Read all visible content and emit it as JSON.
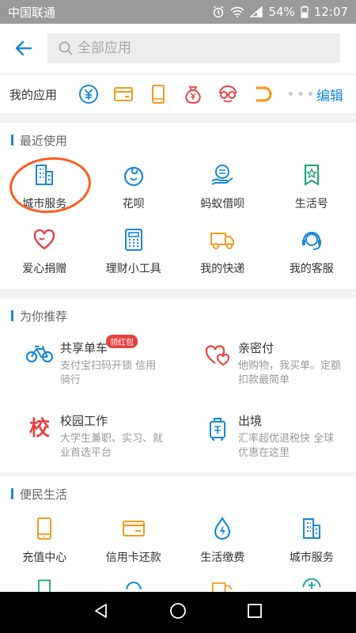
{
  "status": {
    "carrier": "中国联通",
    "battery": "54%",
    "time": "12:07"
  },
  "search": {
    "placeholder": "全部应用"
  },
  "my_apps": {
    "label": "我的应用",
    "icons": [
      "yuan-circle-icon",
      "bank-card-icon",
      "phone-recharge-icon",
      "money-bag-icon",
      "glasses-face-icon",
      "didi-icon"
    ],
    "more": "•••",
    "edit": "编辑"
  },
  "recent": {
    "title": "最近使用",
    "items": [
      {
        "label": "城市服务",
        "icon": "city-building-icon"
      },
      {
        "label": "花呗",
        "icon": "huabei-icon"
      },
      {
        "label": "蚂蚁借呗",
        "icon": "hand-loan-icon"
      },
      {
        "label": "生活号",
        "icon": "bookmark-star-icon"
      },
      {
        "label": "爱心捐赠",
        "icon": "heart-icon"
      },
      {
        "label": "理财小工具",
        "icon": "calculator-icon"
      },
      {
        "label": "我的快递",
        "icon": "truck-icon"
      },
      {
        "label": "我的客服",
        "icon": "headset-icon"
      }
    ]
  },
  "recommend": {
    "title": "为你推荐",
    "items": [
      {
        "title": "共享单车",
        "desc": "支付宝扫码开锁 信用骑行",
        "badge": "领红包",
        "icon": "bicycle-icon"
      },
      {
        "title": "亲密付",
        "desc": "他购物，我买单。定额扣款最简单",
        "icon": "hearts-icon"
      },
      {
        "title": "校园工作",
        "desc": "大学生兼职、实习、就业首选平台",
        "icon": "school-job-icon",
        "glyph": "校"
      },
      {
        "title": "出境",
        "desc": "汇率超优退税快 全球优惠在这里",
        "icon": "luggage-icon"
      }
    ]
  },
  "life": {
    "title": "便民生活",
    "items": [
      {
        "label": "充值中心",
        "icon": "phone-recharge-icon"
      },
      {
        "label": "信用卡还款",
        "icon": "credit-card-icon"
      },
      {
        "label": "生活缴费",
        "icon": "water-drop-icon"
      },
      {
        "label": "城市服务",
        "icon": "city-building-icon"
      }
    ]
  },
  "colors": {
    "accent": "#1a87d8",
    "orange": "#f39a1e",
    "red": "#e64340",
    "annotation": "#ff5a1f"
  }
}
